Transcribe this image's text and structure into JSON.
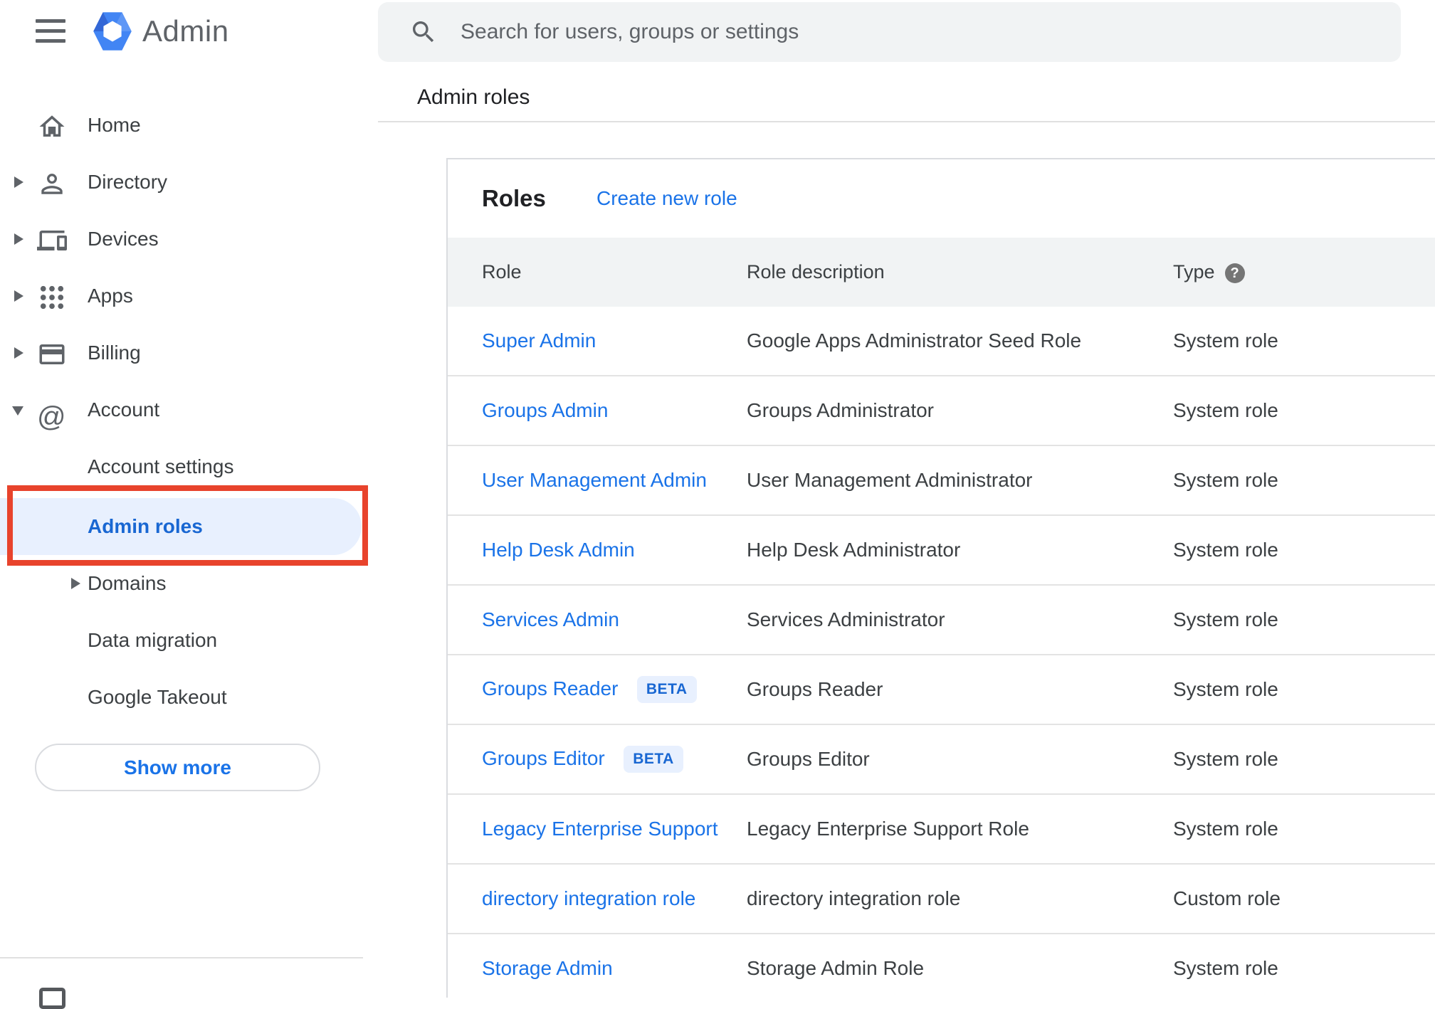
{
  "app": {
    "title": "Admin"
  },
  "search": {
    "placeholder": "Search for users, groups or settings"
  },
  "breadcrumb": "Admin roles",
  "sidebar": {
    "items": [
      {
        "label": "Home"
      },
      {
        "label": "Directory"
      },
      {
        "label": "Devices"
      },
      {
        "label": "Apps"
      },
      {
        "label": "Billing"
      },
      {
        "label": "Account"
      }
    ],
    "account_children": [
      {
        "label": "Account settings"
      },
      {
        "label": "Admin roles",
        "selected": true
      },
      {
        "label": "Domains"
      },
      {
        "label": "Data migration"
      },
      {
        "label": "Google Takeout"
      }
    ],
    "show_more_label": "Show more"
  },
  "main": {
    "card_title": "Roles",
    "create_link": "Create new role",
    "columns": [
      "Role",
      "Role description",
      "Type"
    ],
    "help_icon_glyph": "?",
    "beta_label": "BETA",
    "rows": [
      {
        "role": "Super Admin",
        "beta": false,
        "description": "Google Apps Administrator Seed Role",
        "type": "System role"
      },
      {
        "role": "Groups Admin",
        "beta": false,
        "description": "Groups Administrator",
        "type": "System role"
      },
      {
        "role": "User Management Admin",
        "beta": false,
        "description": "User Management Administrator",
        "type": "System role"
      },
      {
        "role": "Help Desk Admin",
        "beta": false,
        "description": "Help Desk Administrator",
        "type": "System role"
      },
      {
        "role": "Services Admin",
        "beta": false,
        "description": "Services Administrator",
        "type": "System role"
      },
      {
        "role": "Groups Reader",
        "beta": true,
        "description": "Groups Reader",
        "type": "System role"
      },
      {
        "role": "Groups Editor",
        "beta": true,
        "description": "Groups Editor",
        "type": "System role"
      },
      {
        "role": "Legacy Enterprise Support",
        "beta": false,
        "description": "Legacy Enterprise Support Role",
        "type": "System role"
      },
      {
        "role": "directory integration role",
        "beta": false,
        "description": "directory integration role",
        "type": "Custom role"
      },
      {
        "role": "Storage Admin",
        "beta": false,
        "description": "Storage Admin Role",
        "type": "System role"
      }
    ]
  },
  "colors": {
    "accent_blue": "#1a73e8",
    "selected_blue": "#1967d2",
    "selected_bg": "#e8f0fe",
    "annotation_red": "#e8432c",
    "header_band": "#f1f3f4"
  }
}
